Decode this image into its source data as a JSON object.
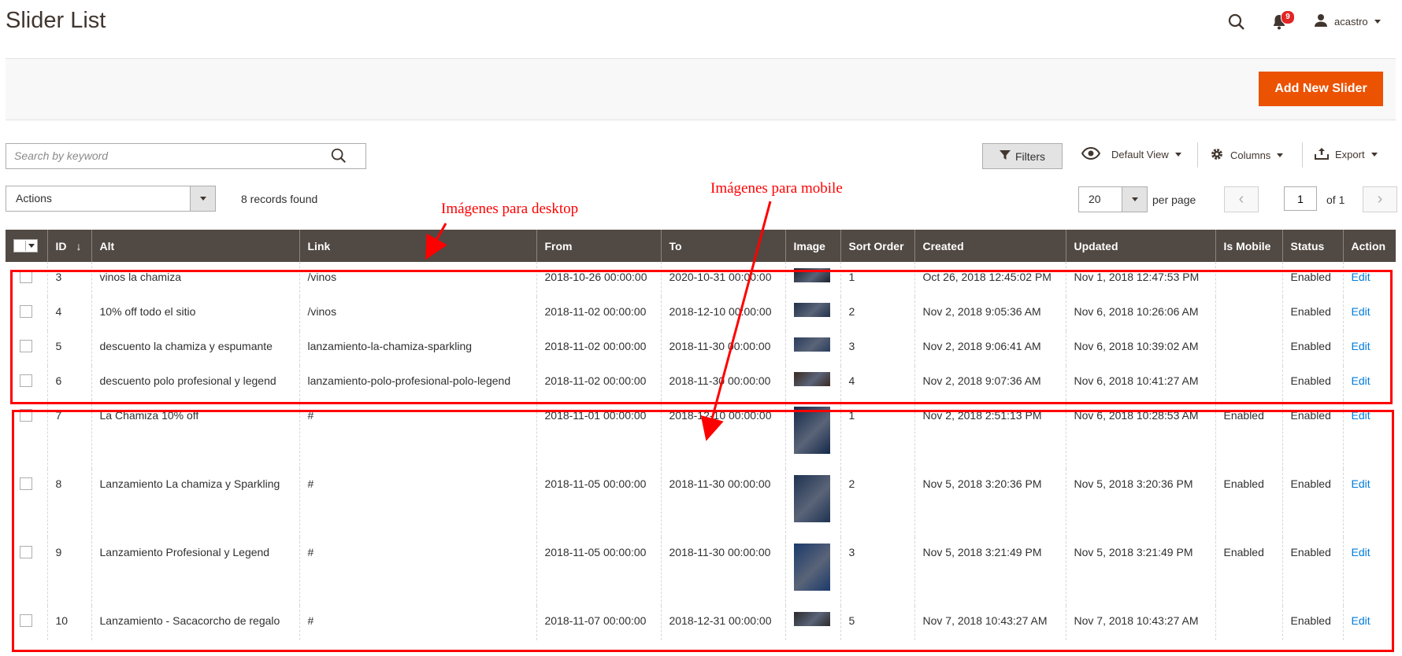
{
  "header": {
    "title": "Slider List",
    "notifications_count": "9",
    "username": "acastro"
  },
  "action_bar": {
    "add_new_label": "Add New Slider"
  },
  "toolbar": {
    "search_placeholder": "Search by keyword",
    "filters_label": "Filters",
    "view_label": "Default View",
    "columns_label": "Columns",
    "export_label": "Export",
    "actions_label": "Actions",
    "records_found": "8 records found",
    "per_page_value": "20",
    "per_page_label": "per page",
    "page_current": "1",
    "page_of": "of 1"
  },
  "grid": {
    "columns": [
      "ID",
      "Alt",
      "Link",
      "From",
      "To",
      "Image",
      "Sort Order",
      "Created",
      "Updated",
      "Is Mobile",
      "Status",
      "Action"
    ],
    "sort_indicator": "↓",
    "rows": [
      {
        "id": "3",
        "alt": "vinos la chamiza",
        "link": "/vinos",
        "from": "2018-10-26 00:00:00",
        "to": "2020-10-31 00:00:00",
        "sort": "1",
        "created": "Oct 26, 2018 12:45:02 PM",
        "updated": "Nov 1, 2018 12:47:53 PM",
        "mobile": "",
        "status": "Enabled",
        "action": "Edit",
        "thumb_color": "#1b2230"
      },
      {
        "id": "4",
        "alt": "10% off todo el sitio",
        "link": "/vinos",
        "from": "2018-11-02 00:00:00",
        "to": "2018-12-10 00:00:00",
        "sort": "2",
        "created": "Nov 2, 2018 9:05:36 AM",
        "updated": "Nov 6, 2018 10:26:06 AM",
        "mobile": "",
        "status": "Enabled",
        "action": "Edit",
        "thumb_color": "#22314a"
      },
      {
        "id": "5",
        "alt": "descuento la chamiza y espumante",
        "link": "lanzamiento-la-chamiza-sparkling",
        "from": "2018-11-02 00:00:00",
        "to": "2018-11-30 00:00:00",
        "sort": "3",
        "created": "Nov 2, 2018 9:06:41 AM",
        "updated": "Nov 6, 2018 10:39:02 AM",
        "mobile": "",
        "status": "Enabled",
        "action": "Edit",
        "thumb_color": "#2b3d5c"
      },
      {
        "id": "6",
        "alt": "descuento polo profesional y legend",
        "link": "lanzamiento-polo-profesional-polo-legend",
        "from": "2018-11-02 00:00:00",
        "to": "2018-11-30 00:00:00",
        "sort": "4",
        "created": "Nov 2, 2018 9:07:36 AM",
        "updated": "Nov 6, 2018 10:41:27 AM",
        "mobile": "",
        "status": "Enabled",
        "action": "Edit",
        "thumb_color": "#3a2a22"
      },
      {
        "id": "7",
        "alt": "La Chamiza 10% off",
        "link": "#",
        "from": "2018-11-01 00:00:00",
        "to": "2018-12-10 00:00:00",
        "sort": "1",
        "created": "Nov 2, 2018 2:51:13 PM",
        "updated": "Nov 6, 2018 10:28:53 AM",
        "mobile": "Enabled",
        "status": "Enabled",
        "action": "Edit",
        "thumb_color": "#15294a"
      },
      {
        "id": "8",
        "alt": "Lanzamiento La chamiza y Sparkling",
        "link": "#",
        "from": "2018-11-05 00:00:00",
        "to": "2018-11-30 00:00:00",
        "sort": "2",
        "created": "Nov 5, 2018 3:20:36 PM",
        "updated": "Nov 5, 2018 3:20:36 PM",
        "mobile": "Enabled",
        "status": "Enabled",
        "action": "Edit",
        "thumb_color": "#1f3352"
      },
      {
        "id": "9",
        "alt": "Lanzamiento Profesional y Legend",
        "link": "#",
        "from": "2018-11-05 00:00:00",
        "to": "2018-11-30 00:00:00",
        "sort": "3",
        "created": "Nov 5, 2018 3:21:49 PM",
        "updated": "Nov 5, 2018 3:21:49 PM",
        "mobile": "Enabled",
        "status": "Enabled",
        "action": "Edit",
        "thumb_color": "#1b3a6b"
      },
      {
        "id": "10",
        "alt": "Lanzamiento - Sacacorcho de regalo",
        "link": "#",
        "from": "2018-11-07 00:00:00",
        "to": "2018-12-31 00:00:00",
        "sort": "5",
        "created": "Nov 7, 2018 10:43:27 AM",
        "updated": "Nov 7, 2018 10:43:27 AM",
        "mobile": "",
        "status": "Enabled",
        "action": "Edit",
        "thumb_color": "#2a2a2a"
      }
    ]
  },
  "annotations": {
    "desktop_label": "Imágenes para desktop",
    "mobile_label": "Imágenes para mobile",
    "color": "#ff0000"
  },
  "colors": {
    "accent": "#eb5202",
    "header_bg": "#514943",
    "link": "#007bdb"
  }
}
